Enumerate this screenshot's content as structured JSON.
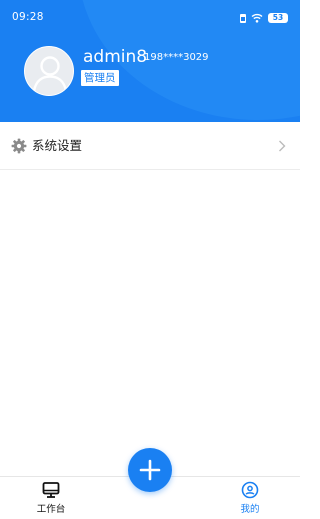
{
  "status_bar": {
    "time": "09:28",
    "battery": "53"
  },
  "profile": {
    "username": "admin8",
    "phone": "198****3029",
    "role": "管理员"
  },
  "menu": {
    "items": [
      {
        "label": "系统设置",
        "icon": "gear-icon"
      }
    ]
  },
  "tab_bar": {
    "tabs": [
      {
        "label": "工作台",
        "icon": "monitor-icon",
        "active": false
      },
      {
        "label": "我的",
        "icon": "user-circle-icon",
        "active": true
      }
    ],
    "add_button": {
      "icon": "plus-icon"
    }
  },
  "colors": {
    "primary": "#1a80f2",
    "header_wave": "#2a8ff6",
    "divider": "#ececec",
    "text_dark": "#222222"
  }
}
